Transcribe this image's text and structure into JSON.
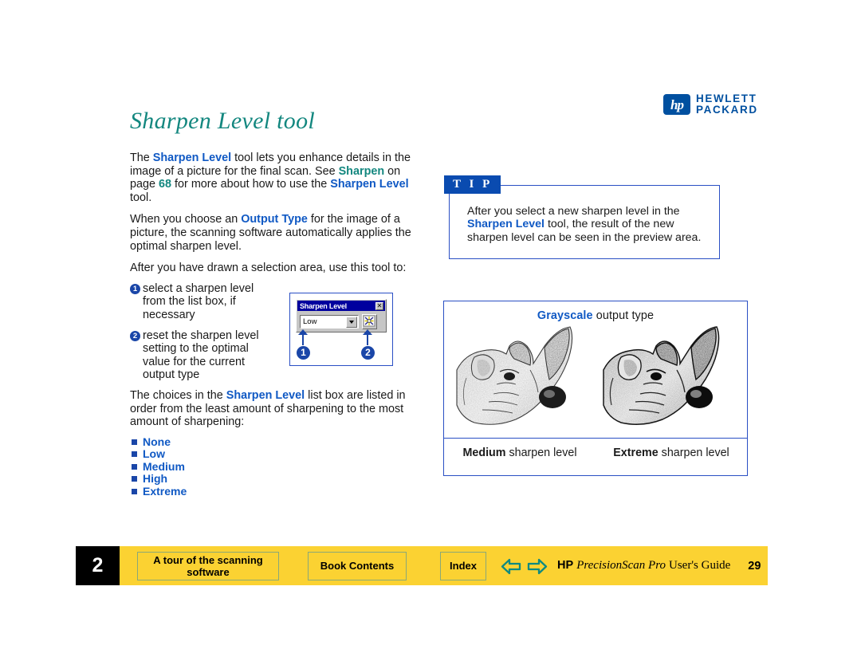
{
  "logo": {
    "mark": "hp",
    "line1": "HEWLETT",
    "line2": "PACKARD"
  },
  "page": {
    "title": "Sharpen Level tool"
  },
  "body": {
    "p1_a": "The ",
    "p1_b": "Sharpen Level",
    "p1_c": " tool lets you enhance details in the image of a picture for the final scan. See ",
    "p1_d": "Sharpen",
    "p1_e": " on page ",
    "p1_f": "68",
    "p1_g": " for more about how to use the ",
    "p1_h": "Sharpen Level",
    "p1_i": " tool.",
    "p2_a": "When you choose an ",
    "p2_b": "Output Type",
    "p2_c": " for the image of a picture, the scanning software automatically applies the optimal sharpen level.",
    "p3": "After you have drawn a selection area, use this tool to:",
    "p4_a": "The choices in the ",
    "p4_b": "Sharpen Level",
    "p4_c": " list box are listed in order from the least amount of sharpening to the most amount of sharpening:"
  },
  "steps": [
    {
      "num": "1",
      "text": "select a sharpen level from the list box, if necessary"
    },
    {
      "num": "2",
      "text": "reset the sharpen level setting to the optimal value for the current output type"
    }
  ],
  "sharpen_choices": [
    "None",
    "Low",
    "Medium",
    "High",
    "Extreme"
  ],
  "dialog": {
    "title": "Sharpen Level",
    "close_label": "✕",
    "combo_value": "Low",
    "callout_1": "1",
    "callout_2": "2"
  },
  "tip": {
    "label": "T I P",
    "text_a": "After you select a new sharpen level in the ",
    "text_b": "Sharpen Level",
    "text_c": " tool, the result of the new sharpen level can be seen in the preview area."
  },
  "preview": {
    "heading_bold": "Grayscale",
    "heading_rest": " output type",
    "left_caption_bold": "Medium",
    "left_caption_rest": " sharpen level",
    "right_caption_bold": "Extreme",
    "right_caption_rest": " sharpen level"
  },
  "footer": {
    "chapter": "2",
    "tour_label": "A tour of the scanning software",
    "contents_label": "Book Contents",
    "index_label": "Index",
    "prev_icon": "arrow-left-icon",
    "next_icon": "arrow-right-icon",
    "guide_hp": "HP",
    "guide_product": "PrecisionScan Pro",
    "guide_suffix": "User's Guide",
    "page_number": "29"
  },
  "colors": {
    "title_teal": "#13877f",
    "link_blue": "#1059c4",
    "accent_navy": "#1a46a8",
    "footer_yellow": "#fbd232",
    "tip_header": "#0a4bb0"
  }
}
